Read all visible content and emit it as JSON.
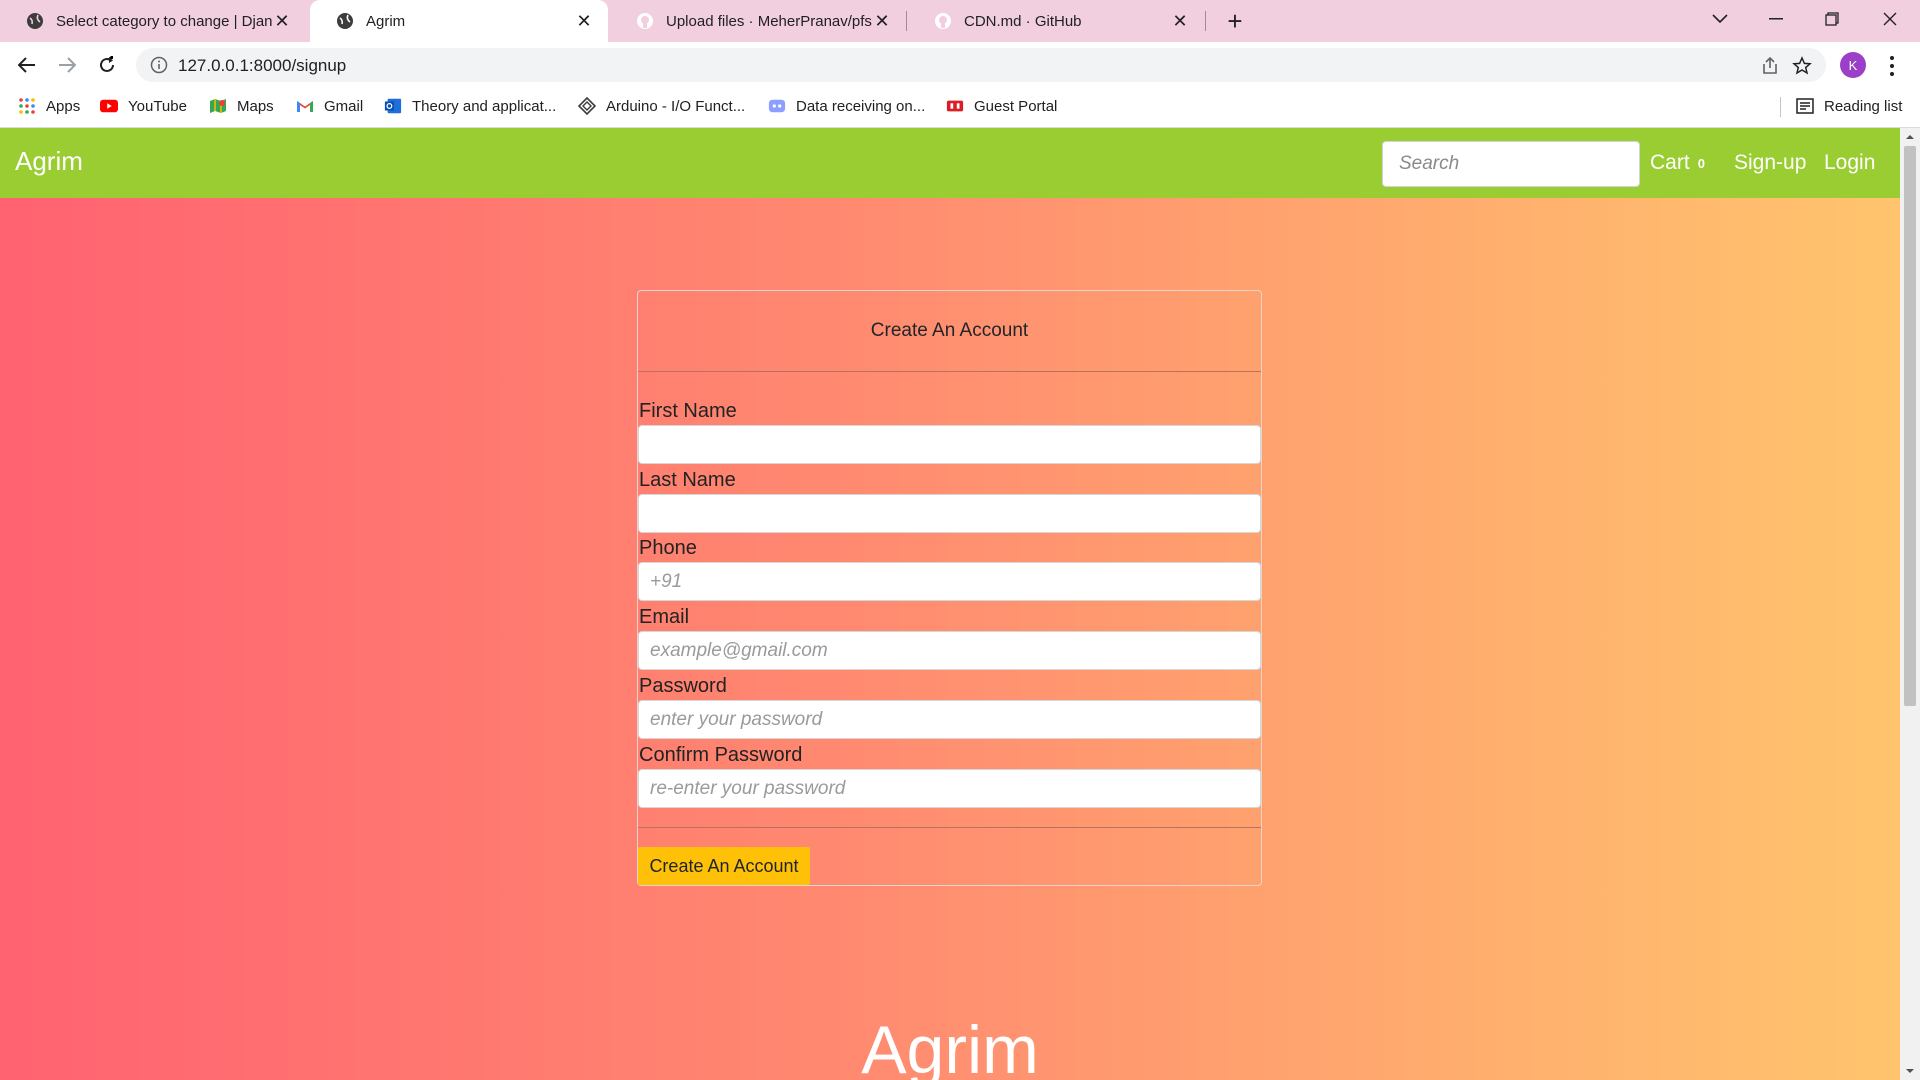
{
  "browser": {
    "tabs": [
      {
        "title": "Select category to change | Djang",
        "icon": "globe-icon"
      },
      {
        "title": "Agrim",
        "icon": "globe-icon",
        "active": true
      },
      {
        "title": "Upload files · MeherPranav/pfsd",
        "icon": "github-icon"
      },
      {
        "title": "CDN.md · GitHub",
        "icon": "github-icon"
      }
    ],
    "url": "127.0.0.1:8000/signup",
    "profile_initial": "K",
    "bookmarks": [
      {
        "label": "Apps",
        "icon": "apps-grid-icon"
      },
      {
        "label": "YouTube",
        "icon": "youtube-icon"
      },
      {
        "label": "Maps",
        "icon": "maps-icon"
      },
      {
        "label": "Gmail",
        "icon": "gmail-icon"
      },
      {
        "label": "Theory and applicat...",
        "icon": "outlook-icon"
      },
      {
        "label": "Arduino - I/O Funct...",
        "icon": "arduino-icon"
      },
      {
        "label": "Data receiving on...",
        "icon": "discord-icon"
      },
      {
        "label": "Guest Portal",
        "icon": "portal-icon"
      }
    ],
    "reading_list": "Reading list"
  },
  "navbar": {
    "brand": "Agrim",
    "search_placeholder": "Search",
    "cart_label": "Cart",
    "cart_count": "0",
    "signup_label": "Sign-up",
    "login_label": "Login"
  },
  "form": {
    "title": "Create An Account",
    "fields": [
      {
        "label": "First Name",
        "placeholder": ""
      },
      {
        "label": "Last Name",
        "placeholder": ""
      },
      {
        "label": "Phone",
        "placeholder": "+91"
      },
      {
        "label": "Email",
        "placeholder": "example@gmail.com"
      },
      {
        "label": "Password",
        "placeholder": "enter your password"
      },
      {
        "label": "Confirm Password",
        "placeholder": "re-enter your password"
      }
    ],
    "submit_label": "Create An Account"
  },
  "footer": {
    "brand": "Agrim"
  },
  "colors": {
    "navbar": "#9acd32",
    "gradient_start": "#ff6271",
    "gradient_end": "#ffc46d",
    "button": "#ffc107",
    "tabstrip": "#f2cfdf"
  }
}
